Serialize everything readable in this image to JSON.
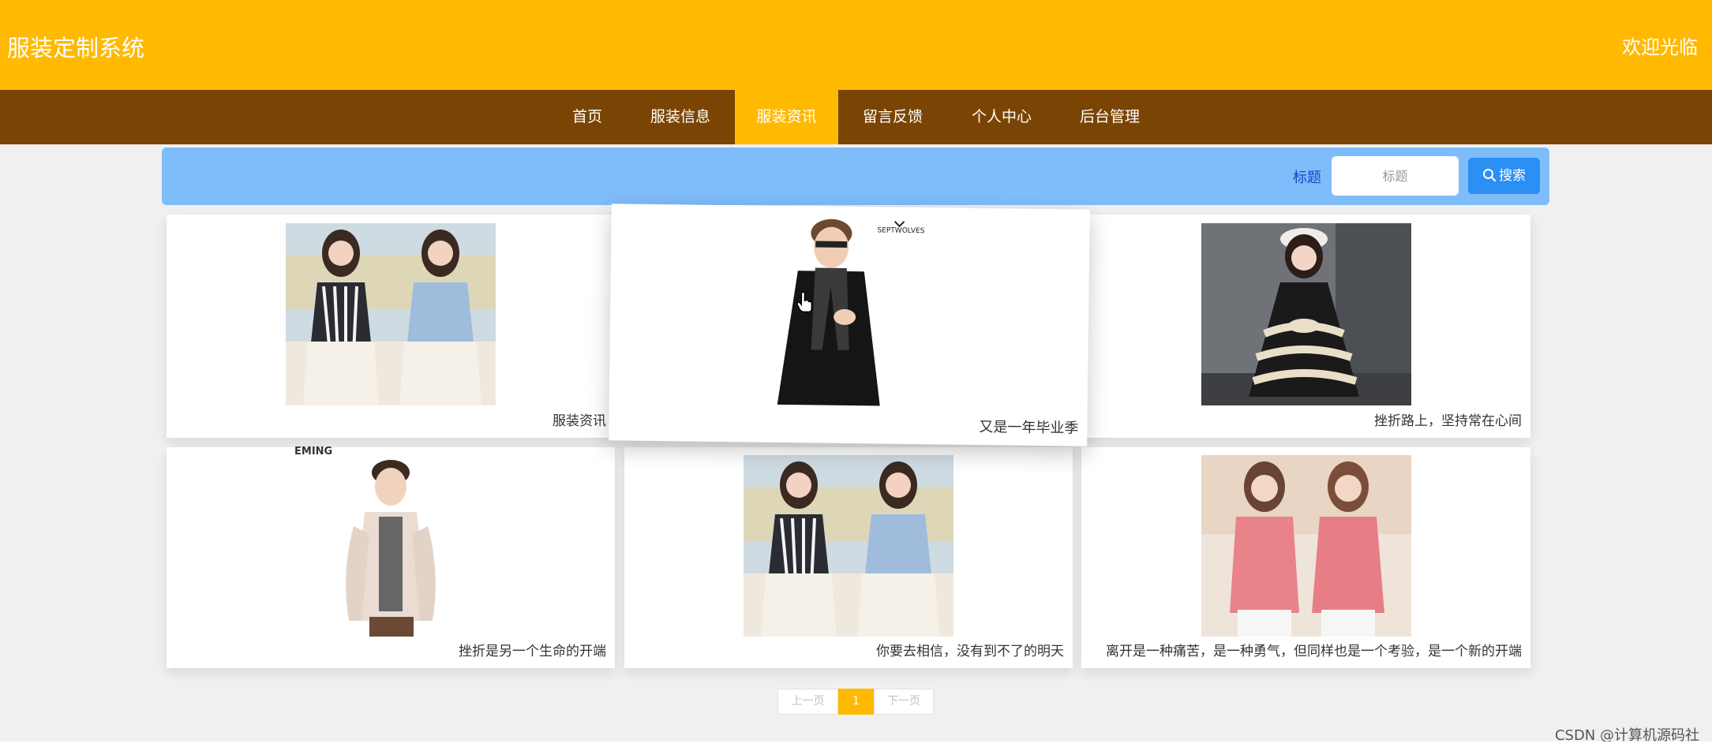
{
  "header": {
    "site_title": "服装定制系统",
    "welcome": "欢迎光临",
    "bg_color": "#ffb901"
  },
  "nav": {
    "bg_color": "#7a4504",
    "items": [
      {
        "label": "首页",
        "active": false
      },
      {
        "label": "服装信息",
        "active": false
      },
      {
        "label": "服装资讯",
        "active": true
      },
      {
        "label": "留言反馈",
        "active": false
      },
      {
        "label": "个人中心",
        "active": false
      },
      {
        "label": "后台管理",
        "active": false
      }
    ]
  },
  "search": {
    "label": "标题",
    "placeholder": "标题",
    "button_label": "搜索",
    "button_icon": "search-icon",
    "bar_color": "#7fbcfa"
  },
  "cards": [
    {
      "title": "服装资讯",
      "image": "two-women-striped-and-blue-lace-dresses"
    },
    {
      "title": "又是一年毕业季",
      "image": "man-black-coat-scarf",
      "logo_text": "SEPTWOLVES"
    },
    {
      "title": "挫折路上，坚持常在心间",
      "image": "girl-black-floral-dress-beret"
    },
    {
      "title": "挫折是另一个生命的开端",
      "image": "man-white-puffer-jacket",
      "logo_text": "EMING"
    },
    {
      "title": "你要去相信，没有到不了的明天",
      "image": "two-women-striped-and-blue-lace-dresses"
    },
    {
      "title": "离开是一种痛苦，是一种勇气，但同样也是一个考验，是一个新的开端",
      "image": "two-women-pink-tops"
    }
  ],
  "pagination": {
    "prev": "上一页",
    "current": "1",
    "next": "下一页"
  },
  "watermark": "CSDN @计算机源码社"
}
